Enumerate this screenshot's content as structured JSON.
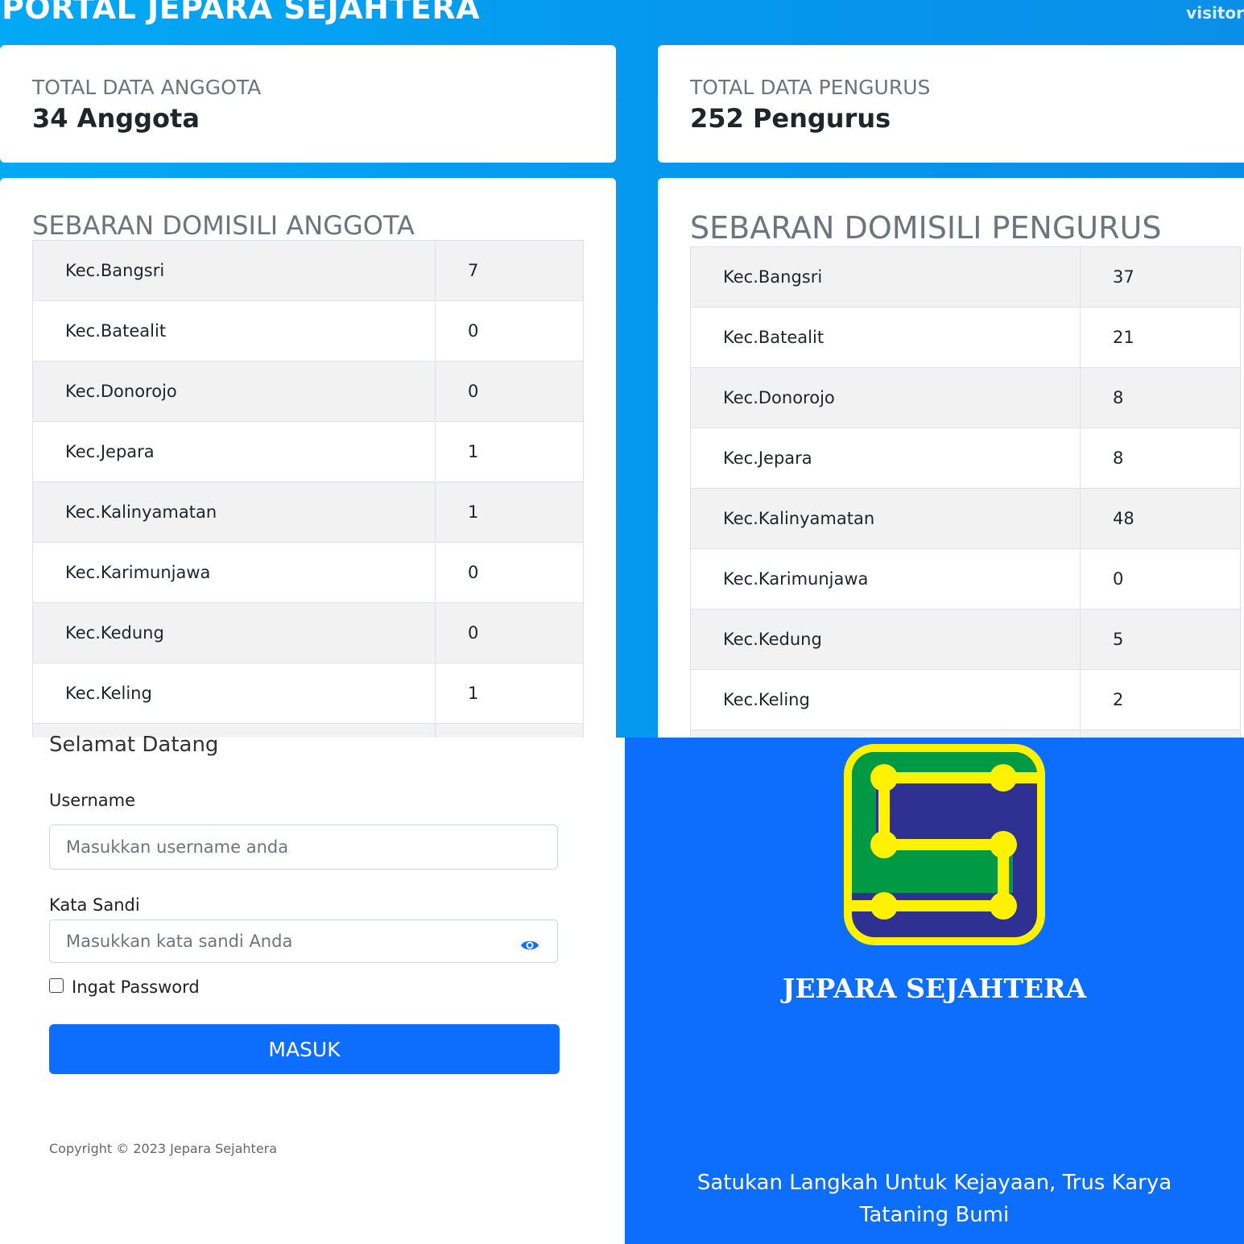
{
  "dashboard": {
    "title": "PORTAL JEPARA SEJAHTERA",
    "visitor_label": "visitor",
    "anggota_card": {
      "label": "TOTAL DATA ANGGOTA",
      "value": "34 Anggota"
    },
    "pengurus_card": {
      "label": "TOTAL DATA PENGURUS",
      "value": "252 Pengurus"
    },
    "anggota_table": {
      "title": "SEBARAN DOMISILI ANGGOTA",
      "rows": [
        {
          "name": "Kec.Bangsri",
          "value": "7"
        },
        {
          "name": "Kec.Batealit",
          "value": "0"
        },
        {
          "name": "Kec.Donorojo",
          "value": "0"
        },
        {
          "name": "Kec.Jepara",
          "value": "1"
        },
        {
          "name": "Kec.Kalinyamatan",
          "value": "1"
        },
        {
          "name": "Kec.Karimunjawa",
          "value": "0"
        },
        {
          "name": "Kec.Kedung",
          "value": "0"
        },
        {
          "name": "Kec.Keling",
          "value": "1"
        }
      ]
    },
    "pengurus_table": {
      "title": "SEBARAN DOMISILI PENGURUS",
      "rows": [
        {
          "name": "Kec.Bangsri",
          "value": "37"
        },
        {
          "name": "Kec.Batealit",
          "value": "21"
        },
        {
          "name": "Kec.Donorojo",
          "value": "8"
        },
        {
          "name": "Kec.Jepara",
          "value": "8"
        },
        {
          "name": "Kec.Kalinyamatan",
          "value": "48"
        },
        {
          "name": "Kec.Karimunjawa",
          "value": "0"
        },
        {
          "name": "Kec.Kedung",
          "value": "5"
        },
        {
          "name": "Kec.Keling",
          "value": "2"
        }
      ]
    }
  },
  "login": {
    "welcome": "Selamat Datang",
    "username_label": "Username",
    "username_placeholder": "Masukkan username anda",
    "password_label": "Kata Sandi",
    "password_placeholder": "Masukkan kata sandi Anda",
    "remember_label": "Ingat Password",
    "submit_label": "MASUK",
    "copyright": "Copyright © 2023 Jepara Sejahtera",
    "show_password_icon": "eye-icon"
  },
  "brand": {
    "name": "JEPARA SEJAHTERA",
    "tagline_line1": "Satukan Langkah Untuk Kejayaan, Trus Karya",
    "tagline_line2": "Tataning Bumi",
    "logo_icon": "jepara-sejahtera-logo",
    "colors": {
      "panel": "#0d6efd",
      "logo_border": "#fff200",
      "logo_top": "#2e3192",
      "logo_middle": "#009a44"
    }
  }
}
